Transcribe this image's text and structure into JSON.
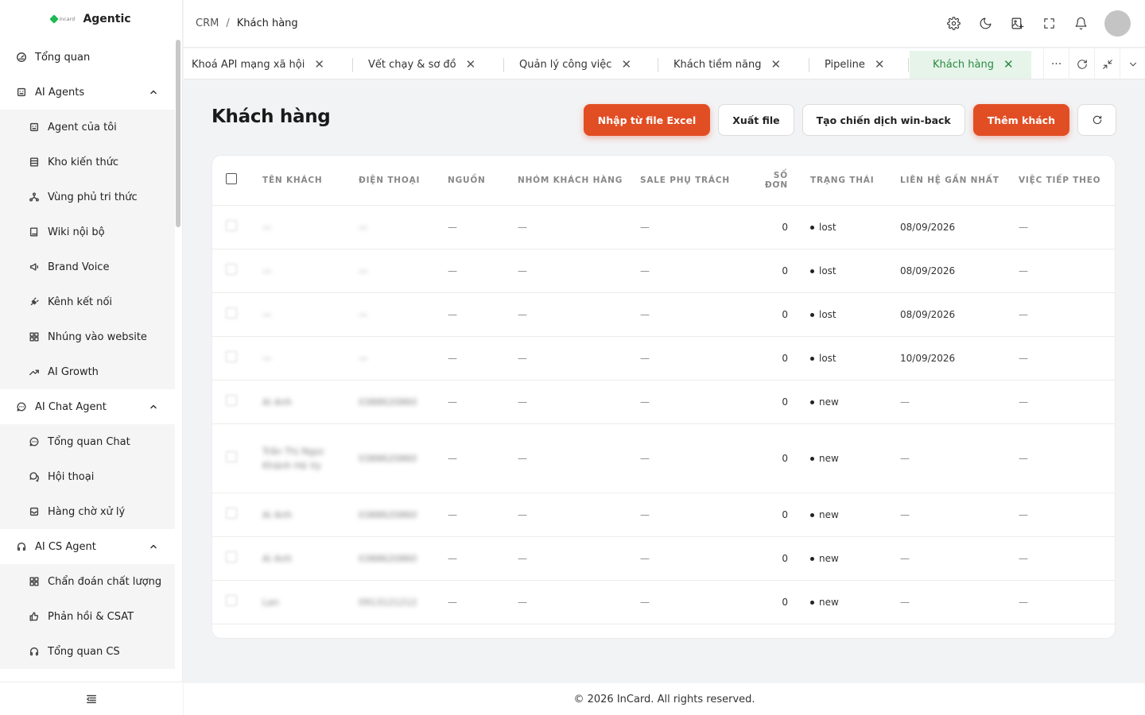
{
  "brand": {
    "logo_text": "incard",
    "name": "Agentic"
  },
  "sidebar": {
    "items": [
      {
        "type": "item",
        "label": "Tổng quan",
        "icon": "gauge-icon"
      },
      {
        "type": "group",
        "label": "AI Agents",
        "icon": "robot-icon"
      },
      {
        "type": "sub",
        "label": "Agent của tôi",
        "icon": "bot-icon"
      },
      {
        "type": "sub",
        "label": "Kho kiến thức",
        "icon": "database-icon"
      },
      {
        "type": "sub",
        "label": "Vùng phủ tri thức",
        "icon": "network-icon"
      },
      {
        "type": "sub",
        "label": "Wiki nội bộ",
        "icon": "book-icon"
      },
      {
        "type": "sub",
        "label": "Brand Voice",
        "icon": "megaphone-icon"
      },
      {
        "type": "sub",
        "label": "Kênh kết nối",
        "icon": "plug-icon"
      },
      {
        "type": "sub",
        "label": "Nhúng vào website",
        "icon": "grid-icon"
      },
      {
        "type": "sub",
        "label": "AI Growth",
        "icon": "trending-up-icon"
      },
      {
        "type": "group",
        "label": "AI Chat Agent",
        "icon": "chat-icon"
      },
      {
        "type": "sub",
        "label": "Tổng quan Chat",
        "icon": "chat-icon"
      },
      {
        "type": "sub",
        "label": "Hội thoại",
        "icon": "messages-icon"
      },
      {
        "type": "sub",
        "label": "Hàng chờ xử lý",
        "icon": "inbox-icon"
      },
      {
        "type": "group",
        "label": "AI CS Agent",
        "icon": "headset-icon"
      },
      {
        "type": "sub",
        "label": "Chẩn đoán chất lượng",
        "icon": "grid-icon"
      },
      {
        "type": "sub",
        "label": "Phản hồi & CSAT",
        "icon": "thumbs-up-icon"
      },
      {
        "type": "sub",
        "label": "Tổng quan CS",
        "icon": "headset-icon"
      }
    ]
  },
  "breadcrumb": {
    "root": "CRM",
    "separator": "/",
    "current": "Khách hàng"
  },
  "tabs": [
    {
      "label": "Khoá API mạng xã hội",
      "active": false
    },
    {
      "label": "Vết chạy & sơ đồ",
      "active": false
    },
    {
      "label": "Quản lý công việc",
      "active": false
    },
    {
      "label": "Khách tiềm năng",
      "active": false
    },
    {
      "label": "Pipeline",
      "active": false
    },
    {
      "label": "Khách hàng",
      "active": true
    }
  ],
  "tab_tools": {
    "more": "···"
  },
  "page": {
    "title": "Khách hàng",
    "buttons": {
      "import": "Nhập từ file Excel",
      "export": "Xuất file",
      "winback": "Tạo chiến dịch win-back",
      "add": "Thêm khách"
    }
  },
  "table": {
    "columns": [
      "Tên khách",
      "Điện thoại",
      "Nguồn",
      "Nhóm khách hàng",
      "Sale phụ trách",
      "Số đơn",
      "Trạng thái",
      "Liên hệ gần nhất",
      "Việc tiếp theo"
    ],
    "rows": [
      {
        "name": "—",
        "phone": "—",
        "source": "—",
        "group": "—",
        "sale": "—",
        "orders": "0",
        "status": "lost",
        "last_contact": "08/09/2026",
        "next": "—",
        "tall": false
      },
      {
        "name": "—",
        "phone": "—",
        "source": "—",
        "group": "—",
        "sale": "—",
        "orders": "0",
        "status": "lost",
        "last_contact": "08/09/2026",
        "next": "—",
        "tall": false
      },
      {
        "name": "—",
        "phone": "—",
        "source": "—",
        "group": "—",
        "sale": "—",
        "orders": "0",
        "status": "lost",
        "last_contact": "08/09/2026",
        "next": "—",
        "tall": false
      },
      {
        "name": "—",
        "phone": "—",
        "source": "—",
        "group": "—",
        "sale": "—",
        "orders": "0",
        "status": "lost",
        "last_contact": "10/09/2026",
        "next": "—",
        "tall": false
      },
      {
        "name": "Ai Anh",
        "phone": "0388620860",
        "source": "—",
        "group": "—",
        "sale": "—",
        "orders": "0",
        "status": "new",
        "last_contact": "—",
        "next": "—",
        "tall": false
      },
      {
        "name": "Trần Thị Ngọc Khánh Hà Vy",
        "phone": "0388620860",
        "source": "—",
        "group": "—",
        "sale": "—",
        "orders": "0",
        "status": "new",
        "last_contact": "—",
        "next": "—",
        "tall": true
      },
      {
        "name": "Ai Anh",
        "phone": "0388620860",
        "source": "—",
        "group": "—",
        "sale": "—",
        "orders": "0",
        "status": "new",
        "last_contact": "—",
        "next": "—",
        "tall": false
      },
      {
        "name": "Ai Anh",
        "phone": "0388620860",
        "source": "—",
        "group": "—",
        "sale": "—",
        "orders": "0",
        "status": "new",
        "last_contact": "—",
        "next": "—",
        "tall": false
      },
      {
        "name": "Lan",
        "phone": "0913121212",
        "source": "—",
        "group": "—",
        "sale": "—",
        "orders": "0",
        "status": "new",
        "last_contact": "—",
        "next": "—",
        "tall": false
      }
    ]
  },
  "footer": {
    "text": "© 2026 InCard. All rights reserved."
  }
}
